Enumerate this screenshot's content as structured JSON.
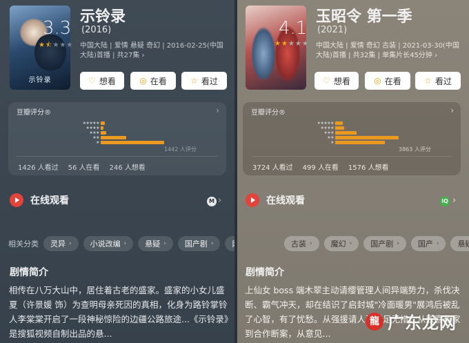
{
  "left": {
    "poster_caption": "示铃录",
    "title": "示铃录",
    "year": "(2016)",
    "meta": "中国大陆 | 爱情 悬疑 奇幻 | 2016-02-25(中国大陆)首播 | 共27集 ›",
    "buttons": {
      "want": "想看",
      "watching": "在看",
      "watched": "看过"
    },
    "card_title": "豆瓣评分®",
    "score": "3.3",
    "stars_filled": 1.5,
    "rating_bars": [
      0.04,
      0.03,
      0.06,
      0.26,
      0.65
    ],
    "rating_count": "1442 人评分",
    "stats": {
      "watched": "1426 人看过",
      "watching": "56 人在看",
      "want": "246 人想看"
    },
    "watch_label": "在线观看",
    "source_icon": "sohu-video-icon",
    "tags_label": "相关分类",
    "tags": [
      "灵异",
      "小说改编",
      "悬疑",
      "国产剧",
      "网"
    ],
    "section_title": "剧情简介",
    "synopsis": "相传在八万大山中，居住着古老的盛家。盛家的小女儿盛夏（许景媛 饰）为查明母亲死因的真相，化身为路铃掌铃人李棠棠开启了一段神秘惊险的边疆公路旅途...《示铃录》是搜狐视频自制出品的悬..."
  },
  "right": {
    "title": "玉昭令 第一季",
    "year": "(2021)",
    "meta": "中国大陆 | 爱情 奇幻 古装 | 2021-03-30(中国大陆)首播 | 共32集 | 单集片长45分钟 ›",
    "buttons": {
      "want": "想看",
      "watching": "在看",
      "watched": "看过"
    },
    "card_title": "豆瓣评分®",
    "score": "4.1",
    "stars_filled": 2,
    "rating_bars": [
      0.05,
      0.06,
      0.14,
      0.42,
      0.33
    ],
    "rating_count": "3863 人评分",
    "stats": {
      "watched": "3724 人看过",
      "watching": "499 人在看",
      "want": "1576 人想看"
    },
    "watch_label": "在线观看",
    "source_icon": "iqiyi-icon",
    "tags_label": "",
    "tags": [
      "古装",
      "魔幻",
      "国产剧",
      "国产",
      "悬疑剧"
    ],
    "section_title": "剧情简介",
    "synopsis": "上仙女 boss 端木翠主动请缨管理人间异端势力，杀伐决断、霸气冲天，却在结识了启封城\"冷面暖男\"展鸿后被乱了心智，有了忧愁。从强援请人到手足无措，从欢喜冤家到合作断案，从意见..."
  },
  "watermark": {
    "text": "广东龙网",
    "logo_char": "龍"
  }
}
